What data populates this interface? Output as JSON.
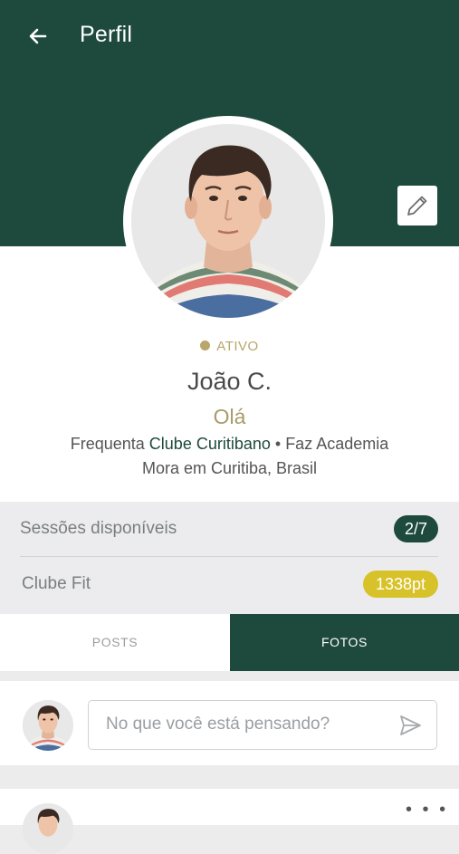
{
  "header": {
    "title": "Perfil",
    "back_icon": "arrow-left-icon",
    "background_color": "#1d4a3c"
  },
  "profile": {
    "status": "ATIVO",
    "status_color": "#b8a66a",
    "name": "João C.",
    "greeting": "Olá",
    "frequents_prefix": "Frequenta ",
    "club": "Clube Curitibano",
    "separator": " • ",
    "activity": "Faz Academia",
    "location": "Mora em Curitiba, Brasil",
    "edit_icon": "pencil-icon"
  },
  "stats": [
    {
      "label": "Sessões disponíveis",
      "value": "2/7",
      "badge_color": "#1d4a3c"
    },
    {
      "label": "Clube Fit",
      "value": "1338pt",
      "badge_color": "#d8c22a"
    }
  ],
  "tabs": [
    {
      "label": "POSTS",
      "active": false
    },
    {
      "label": "FOTOS",
      "active": true
    }
  ],
  "compose": {
    "placeholder": "No que você está pensando?",
    "send_icon": "send-icon"
  }
}
